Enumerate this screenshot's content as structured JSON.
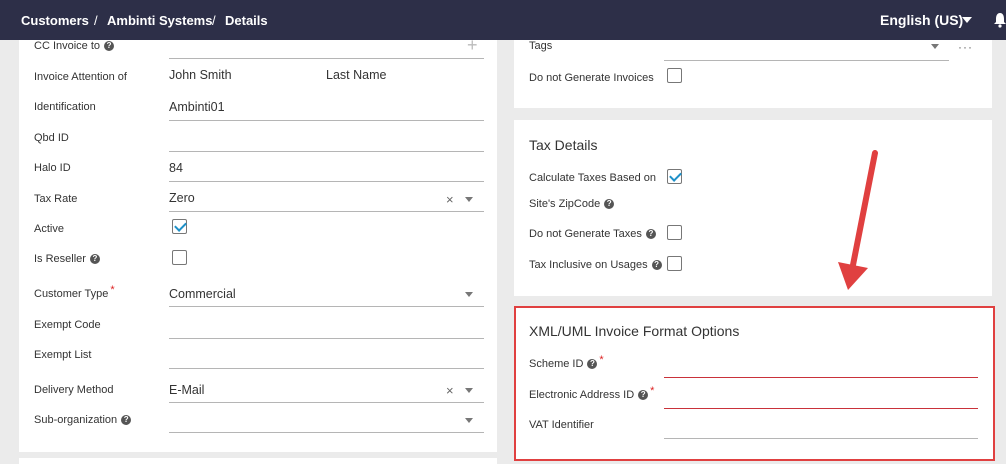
{
  "breadcrumb": {
    "customers": "Customers",
    "company": "Ambinti Systems",
    "details": "Details",
    "separator": "/"
  },
  "header": {
    "language": "English (US)"
  },
  "left_form": {
    "cc_invoice_to": {
      "label": "CC Invoice to"
    },
    "invoice_attention": {
      "label": "Invoice Attention of",
      "first_name": "John Smith",
      "last_name": "Last Name"
    },
    "identification": {
      "label": "Identification",
      "value": "Ambinti01"
    },
    "qbd_id": {
      "label": "Qbd ID",
      "value": ""
    },
    "halo_id": {
      "label": "Halo ID",
      "value": "84"
    },
    "tax_rate": {
      "label": "Tax Rate",
      "value": "Zero"
    },
    "active": {
      "label": "Active",
      "checked": true
    },
    "is_reseller": {
      "label": "Is Reseller",
      "checked": false
    },
    "customer_type": {
      "label": "Customer Type",
      "value": "Commercial",
      "required_mark": "*"
    },
    "exempt_code": {
      "label": "Exempt Code",
      "value": ""
    },
    "exempt_list": {
      "label": "Exempt List",
      "value": ""
    },
    "delivery_method": {
      "label": "Delivery Method",
      "value": "E-Mail"
    },
    "sub_organization": {
      "label": "Sub-organization",
      "value": ""
    }
  },
  "top_right": {
    "tags": {
      "label": "Tags"
    },
    "do_not_generate_invoices": {
      "label": "Do not Generate Invoices",
      "checked": false
    }
  },
  "tax_details": {
    "title": "Tax Details",
    "calculate_taxes_line1": "Calculate Taxes Based on",
    "calculate_taxes_line2": "Site's ZipCode",
    "calculate_taxes_checked": true,
    "do_not_generate_taxes": {
      "label": "Do not Generate Taxes",
      "checked": false
    },
    "tax_inclusive": {
      "label": "Tax Inclusive on Usages",
      "checked": false
    }
  },
  "xml_options": {
    "title": "XML/UML Invoice Format Options",
    "scheme_id": {
      "label": "Scheme ID",
      "required_mark": "*"
    },
    "electronic_address_id": {
      "label": "Electronic Address ID",
      "required_mark": "*"
    },
    "vat_identifier": {
      "label": "VAT Identifier"
    }
  },
  "icons": {
    "help": "?",
    "clear": "×",
    "add": "+",
    "more": "···"
  },
  "colors": {
    "topbar": "#2d2f48",
    "highlight": "#e04040",
    "checkmark": "#1e90c8",
    "required": "#d22222"
  }
}
